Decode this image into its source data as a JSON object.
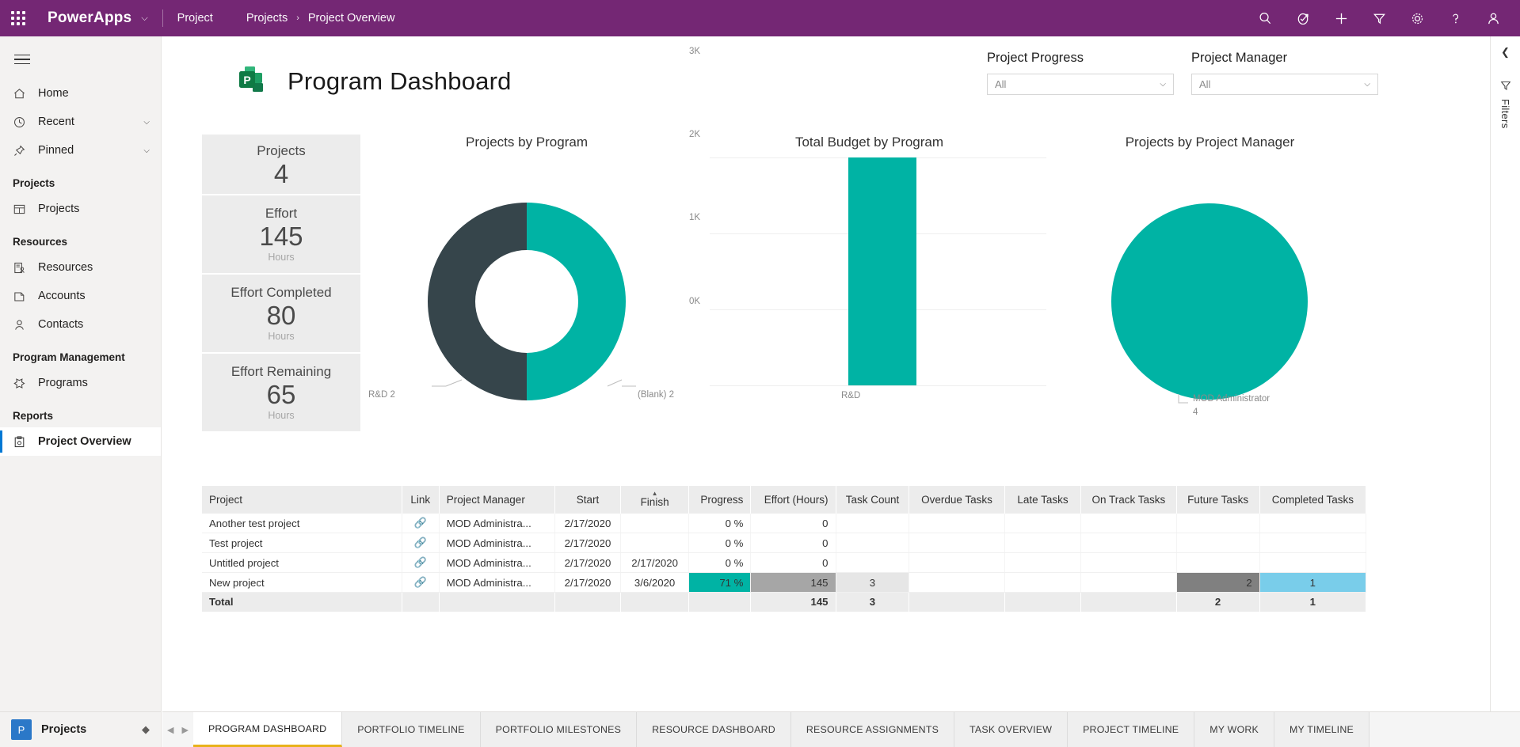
{
  "topbar": {
    "waffle": "app-launcher",
    "brand": "PowerApps",
    "app_link": "Project",
    "breadcrumb": [
      "Projects",
      "Project Overview"
    ],
    "breadcrumb_sep": "›",
    "icons": [
      "search-icon",
      "tasks-icon",
      "add-icon",
      "filter-icon",
      "settings-icon",
      "help-icon",
      "account-icon"
    ],
    "accent": "#742774"
  },
  "sidebar": {
    "hamburger": "hamburger-icon",
    "items": [
      {
        "label": "Home",
        "icon": "home-icon",
        "chevron": false
      },
      {
        "label": "Recent",
        "icon": "clock-icon",
        "chevron": true
      },
      {
        "label": "Pinned",
        "icon": "pin-icon",
        "chevron": true
      }
    ],
    "groups": [
      {
        "title": "Projects",
        "items": [
          {
            "label": "Projects",
            "icon": "project-grid-icon",
            "selected": false
          }
        ]
      },
      {
        "title": "Resources",
        "items": [
          {
            "label": "Resources",
            "icon": "resources-icon",
            "selected": false
          },
          {
            "label": "Accounts",
            "icon": "accounts-icon",
            "selected": false
          },
          {
            "label": "Contacts",
            "icon": "contact-icon",
            "selected": false
          }
        ]
      },
      {
        "title": "Program Management",
        "items": [
          {
            "label": "Programs",
            "icon": "programs-icon",
            "selected": false
          }
        ]
      },
      {
        "title": "Reports",
        "items": [
          {
            "label": "Project Overview",
            "icon": "report-icon",
            "selected": true
          }
        ]
      }
    ],
    "app_switcher": {
      "badge": "P",
      "name": "Projects",
      "updown": "update-icon"
    }
  },
  "right_rail": {
    "collapse": "chevron-left-icon",
    "filter_icon": "filter-icon",
    "filter_label": "Filters"
  },
  "report": {
    "logo": "ms-project-logo",
    "title": "Program Dashboard",
    "slicers": [
      {
        "label": "Project Progress",
        "value": "All",
        "chevron": "chevron-down-icon"
      },
      {
        "label": "Project Manager",
        "value": "All",
        "chevron": "chevron-down-icon"
      }
    ],
    "kpis": [
      {
        "title": "Projects",
        "value": "4",
        "unit": ""
      },
      {
        "title": "Effort",
        "value": "145",
        "unit": "Hours"
      },
      {
        "title": "Effort Completed",
        "value": "80",
        "unit": "Hours"
      },
      {
        "title": "Effort Remaining",
        "value": "65",
        "unit": "Hours"
      }
    ]
  },
  "chart_data": [
    {
      "type": "pie",
      "title": "Projects by Program",
      "variant": "donut",
      "labels": [
        "R&D",
        "(Blank)"
      ],
      "values": [
        2,
        2
      ],
      "colors": [
        "#36454b",
        "#00b3a4"
      ],
      "annotations": [
        "R&D 2",
        "(Blank) 2"
      ],
      "legend": "none",
      "grid": false
    },
    {
      "type": "bar",
      "title": "Total Budget by Program",
      "categories": [
        "R&D"
      ],
      "values": [
        3000
      ],
      "xlabel": "",
      "ylabel": "",
      "ylim": [
        0,
        3000
      ],
      "yticks": [
        "0K",
        "1K",
        "2K",
        "3K"
      ],
      "ytick_values": [
        0,
        1000,
        2000,
        3000
      ],
      "colors": [
        "#00b3a4"
      ],
      "grid": true,
      "legend": "none"
    },
    {
      "type": "pie",
      "title": "Projects by Project Manager",
      "variant": "pie",
      "labels": [
        "MOD Administrator"
      ],
      "values": [
        4
      ],
      "colors": [
        "#00b3a4"
      ],
      "annotations": [
        "MOD Administrator",
        "4"
      ],
      "legend": "none",
      "grid": false
    }
  ],
  "chart_actions": {
    "filter": "filter-icon",
    "focus": "focus-mode-icon",
    "more": "more-options-icon"
  },
  "table": {
    "columns": [
      {
        "label": "Project",
        "align": "l"
      },
      {
        "label": "Link",
        "align": "c"
      },
      {
        "label": "Project Manager",
        "align": "l"
      },
      {
        "label": "Start",
        "align": "c"
      },
      {
        "label": "Finish",
        "align": "c",
        "sorted": "asc"
      },
      {
        "label": "Progress",
        "align": "r"
      },
      {
        "label": "Effort (Hours)",
        "align": "r"
      },
      {
        "label": "Task Count",
        "align": "c"
      },
      {
        "label": "Overdue Tasks",
        "align": "c"
      },
      {
        "label": "Late Tasks",
        "align": "c"
      },
      {
        "label": "On Track Tasks",
        "align": "c"
      },
      {
        "label": "Future Tasks",
        "align": "c"
      },
      {
        "label": "Completed Tasks",
        "align": "c"
      }
    ],
    "rows": [
      {
        "project": "Another test project",
        "link": "link-icon",
        "manager": "MOD Administra...",
        "start": "2/17/2020",
        "finish": "",
        "progress": "0 %",
        "progress_pct": 0,
        "effort": "0",
        "effort_pct": 0,
        "task_count": "",
        "overdue": "",
        "late": "",
        "on_track": "",
        "future": "",
        "future_pct": 0,
        "completed": "",
        "completed_pct": 0
      },
      {
        "project": "Test project",
        "link": "link-icon",
        "manager": "MOD Administra...",
        "start": "2/17/2020",
        "finish": "",
        "progress": "0 %",
        "progress_pct": 0,
        "effort": "0",
        "effort_pct": 0,
        "task_count": "",
        "overdue": "",
        "late": "",
        "on_track": "",
        "future": "",
        "future_pct": 0,
        "completed": "",
        "completed_pct": 0
      },
      {
        "project": "Untitled project",
        "link": "link-icon",
        "manager": "MOD Administra...",
        "start": "2/17/2020",
        "finish": "2/17/2020",
        "progress": "0 %",
        "progress_pct": 0,
        "effort": "0",
        "effort_pct": 0,
        "task_count": "",
        "overdue": "",
        "late": "",
        "on_track": "",
        "future": "",
        "future_pct": 0,
        "completed": "",
        "completed_pct": 0
      },
      {
        "project": "New project",
        "link": "link-icon",
        "manager": "MOD Administra...",
        "start": "2/17/2020",
        "finish": "3/6/2020",
        "progress": "71 %",
        "progress_pct": 71,
        "effort": "145",
        "effort_pct": 100,
        "task_count": "3",
        "overdue": "",
        "late": "",
        "on_track": "",
        "future": "2",
        "future_pct": 100,
        "completed": "1",
        "completed_pct": 100
      }
    ],
    "total": {
      "label": "Total",
      "effort": "145",
      "task_count": "3",
      "future": "2",
      "completed": "1"
    },
    "colors": {
      "progress_fill": "#00b3a4",
      "effort_fill": "#a6a6a6",
      "future_fill": "#808080",
      "completed_fill": "#79cdea"
    }
  },
  "tabbar": {
    "prev": "chevron-left-icon",
    "next": "chevron-right-icon",
    "tabs": [
      {
        "label": "PROGRAM DASHBOARD",
        "active": true
      },
      {
        "label": "PORTFOLIO TIMELINE",
        "active": false
      },
      {
        "label": "PORTFOLIO MILESTONES",
        "active": false
      },
      {
        "label": "RESOURCE DASHBOARD",
        "active": false
      },
      {
        "label": "RESOURCE ASSIGNMENTS",
        "active": false
      },
      {
        "label": "TASK OVERVIEW",
        "active": false
      },
      {
        "label": "PROJECT TIMELINE",
        "active": false
      },
      {
        "label": "MY WORK",
        "active": false
      },
      {
        "label": "MY TIMELINE",
        "active": false
      }
    ]
  }
}
